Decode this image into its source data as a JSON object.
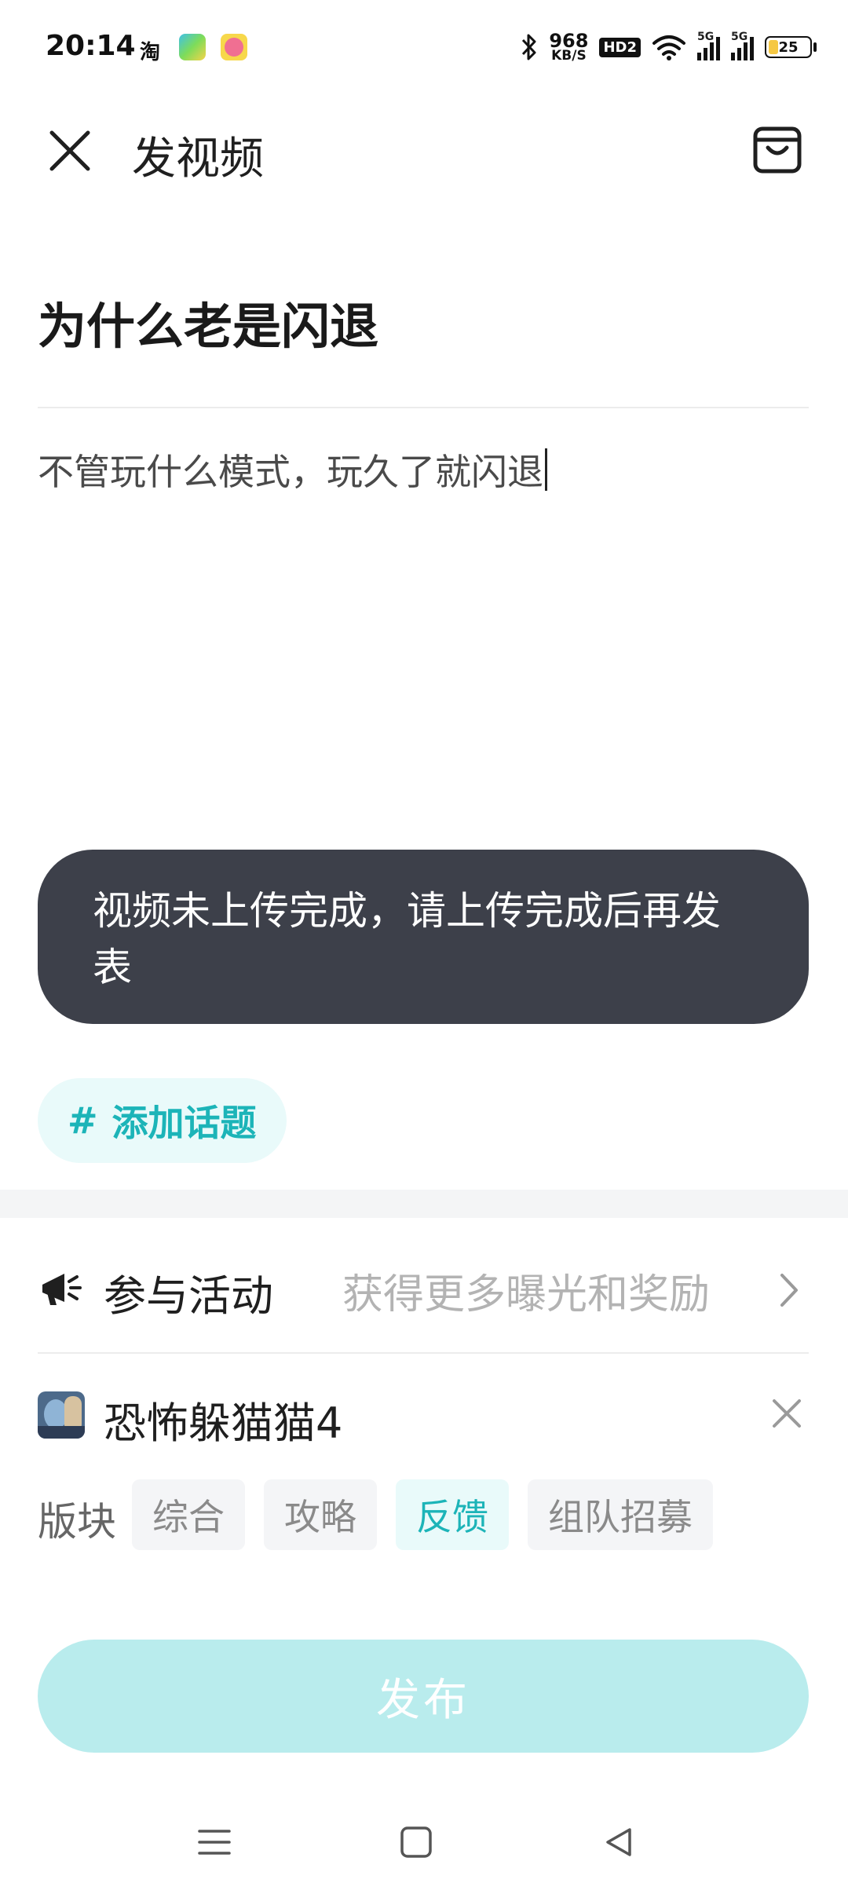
{
  "status_bar": {
    "time": "20:14",
    "app_icons": [
      "taobao-icon",
      "app-icon-green",
      "app-icon-pink"
    ],
    "taobao_glyph": "淘",
    "net_speed_value": "968",
    "net_speed_unit": "KB/S",
    "hd_badge": "HD2",
    "signal_5g_1": "5G",
    "signal_5g_2": "5G",
    "battery": "25",
    "battery_level": 0.25
  },
  "header": {
    "title": "发视频"
  },
  "post": {
    "title": "为什么老是闪退",
    "body": "不管玩什么模式，玩久了就闪退"
  },
  "toast": {
    "message": "视频未上传完成，请上传完成后再发表"
  },
  "topic": {
    "hash": "#",
    "label": "添加话题"
  },
  "activity": {
    "label": "参与活动",
    "hint": "获得更多曝光和奖励"
  },
  "game": {
    "name": "恐怖躲猫猫4"
  },
  "section": {
    "label": "版块",
    "tags": [
      "综合",
      "攻略",
      "反馈",
      "组队招募"
    ],
    "selected": "反馈"
  },
  "publish_button": {
    "label": "发布"
  },
  "colors": {
    "accent": "#1cb4b8",
    "accent_light_bg": "#e9fafa",
    "publish_disabled": "#b9eced",
    "toast_bg": "#3d404a"
  }
}
